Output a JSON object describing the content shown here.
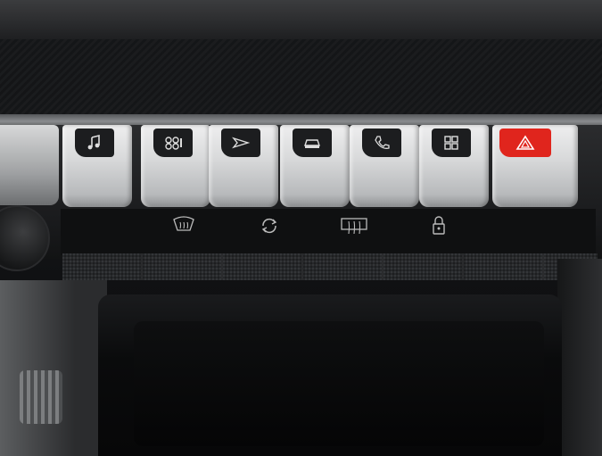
{
  "controls": {
    "buttons": [
      {
        "icon": "music-note-icon"
      },
      {
        "icon": "climate-fan-icon"
      },
      {
        "icon": "navigation-arrow-icon"
      },
      {
        "icon": "car-settings-icon"
      },
      {
        "icon": "phone-handset-icon"
      },
      {
        "icon": "apps-grid-icon"
      },
      {
        "icon": "hazard-warning-icon"
      }
    ],
    "hazard_color": "#e0251d",
    "printed_icons": [
      {
        "icon": "windshield-defrost-icon"
      },
      {
        "icon": "air-recirculation-icon"
      },
      {
        "icon": "rear-defrost-icon"
      },
      {
        "icon": "door-lock-icon"
      }
    ]
  }
}
